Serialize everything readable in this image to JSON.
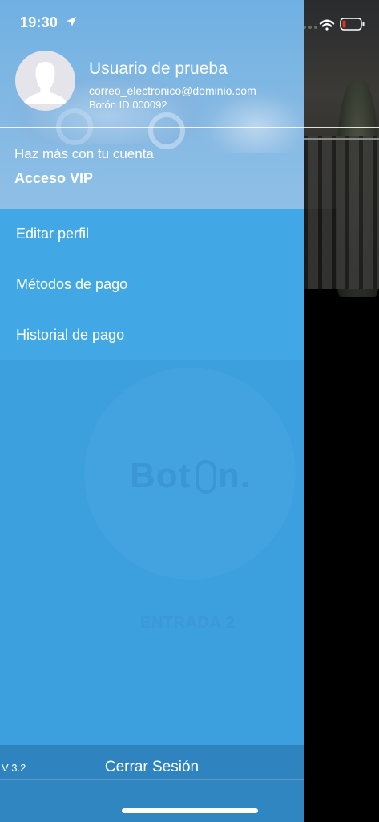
{
  "status_bar": {
    "time": "19:30",
    "location_icon": "location-arrow-icon",
    "wifi_icon": "wifi-icon",
    "battery_icon": "battery-low-icon",
    "battery_level": 0.15,
    "battery_color": "#e2312b"
  },
  "profile": {
    "avatar_icon": "user-silhouette-icon",
    "name": "Usuario de prueba",
    "email": "correo_electronico@dominio.com",
    "id": "Botón ID 000092"
  },
  "promo": {
    "subtitle": "Haz más con tu cuenta",
    "title": "Acceso VIP"
  },
  "menu": {
    "items": [
      {
        "label": "Editar perfil"
      },
      {
        "label": "Métodos de pago"
      },
      {
        "label": "Historial de pago"
      }
    ]
  },
  "background": {
    "logo_text": "Bot",
    "logo_suffix": "n.",
    "entry_label": "ENTRADA 2"
  },
  "footer": {
    "version": "V 3.2",
    "logout_label": "Cerrar Sesión"
  },
  "colors": {
    "drawer": "#3c9fde",
    "menu": "#41a8e5",
    "footer": "#2f86c0"
  }
}
